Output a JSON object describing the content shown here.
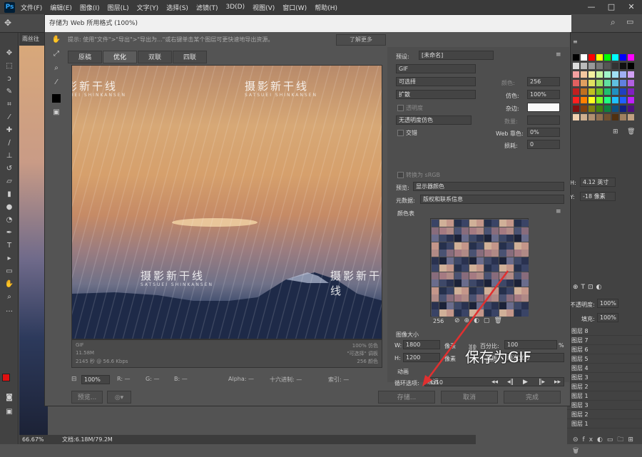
{
  "menubar": {
    "logo": "Ps",
    "items": [
      "文件(F)",
      "编辑(E)",
      "图像(I)",
      "图层(L)",
      "文字(Y)",
      "选择(S)",
      "滤镜(T)",
      "3D(D)",
      "视图(V)",
      "窗口(W)",
      "帮助(H)"
    ],
    "controls": [
      "—",
      "□",
      "✕"
    ]
  },
  "document_tab": "雨丝往",
  "dialog": {
    "title": "存储为 Web 所用格式 (100%)",
    "hint": "提示: 使用\"文件\">\"导出\">\"导出为...\"或右键单击某个图层可更快速地导出资源。",
    "learn_more": "了解更多",
    "tabs": [
      "原稿",
      "优化",
      "双联",
      "四联"
    ],
    "active_tab": "优化",
    "watermark": {
      "title": "摄影新干线",
      "subtitle": "SATSUEI SHINKANSEN"
    },
    "image_info_left": [
      "GIF",
      "11.58M",
      "2145 秒 @ 56.6 Kbps"
    ],
    "image_info_right": [
      "100% 仿色",
      "\"可选择\" 调板",
      "256 颜色"
    ],
    "status": {
      "zoom": "100%",
      "r": "R: —",
      "g": "G: —",
      "b": "B: —",
      "alpha": "Alpha: —",
      "hex": "十六进制: —",
      "index": "索引: —"
    },
    "buttons": {
      "preview": "预览...",
      "save": "存储...",
      "cancel": "取消",
      "done": "完成"
    }
  },
  "settings": {
    "preset_label": "预设:",
    "preset_value": "[未命名]",
    "format": "GIF",
    "reduction": "可选择",
    "colors_label": "颜色:",
    "colors_value": "256",
    "dither_algo": "扩散",
    "dither_label": "仿色:",
    "dither_value": "100%",
    "transparency_label": "透明度",
    "matte_label": "杂边:",
    "transparency_dither": "无透明度仿色",
    "amount_label": "数量:",
    "interlaced_label": "交错",
    "web_snap_label": "Web 靠色:",
    "web_snap_value": "0%",
    "lossy_label": "损耗:",
    "lossy_value": "0",
    "convert_srgb": "转换为 sRGB",
    "preview_label": "预览:",
    "preview_value": "显示器颜色",
    "metadata_label": "元数据:",
    "metadata_value": "版权和联系信息",
    "color_table_label": "颜色表",
    "color_count": "256",
    "image_size_label": "图像大小",
    "w_label": "W:",
    "w_value": "1800",
    "h_label": "H:",
    "h_value": "1200",
    "unit": "像素",
    "percent_label": "百分比:",
    "percent_value": "100",
    "percent_unit": "%",
    "quality_label": "品质:",
    "quality_value": "两次立方",
    "animation_label": "动画",
    "loop_label": "循环选项:",
    "loop_value": "永远",
    "frame_counter": "1/10"
  },
  "right_panel": {
    "w_label": "H:",
    "w_value": "4.12 英寸",
    "y_label": "Y:",
    "y_value": "-18 像素",
    "opacity_label": "不透明度:",
    "opacity_value": "100%",
    "fill_label": "填充:",
    "fill_value": "100%",
    "layers": [
      "8",
      "7",
      "6",
      "5",
      "4",
      "3",
      "2",
      "1",
      "3",
      "2",
      "1"
    ]
  },
  "annotation": "保存为GIF",
  "bottom_status": {
    "zoom": "66.67%",
    "doc": "文档:6.18M/79.2M"
  },
  "colors": {
    "accent_arrow": "#e03030",
    "foreground": "#e01010",
    "background": "#ffffff"
  }
}
